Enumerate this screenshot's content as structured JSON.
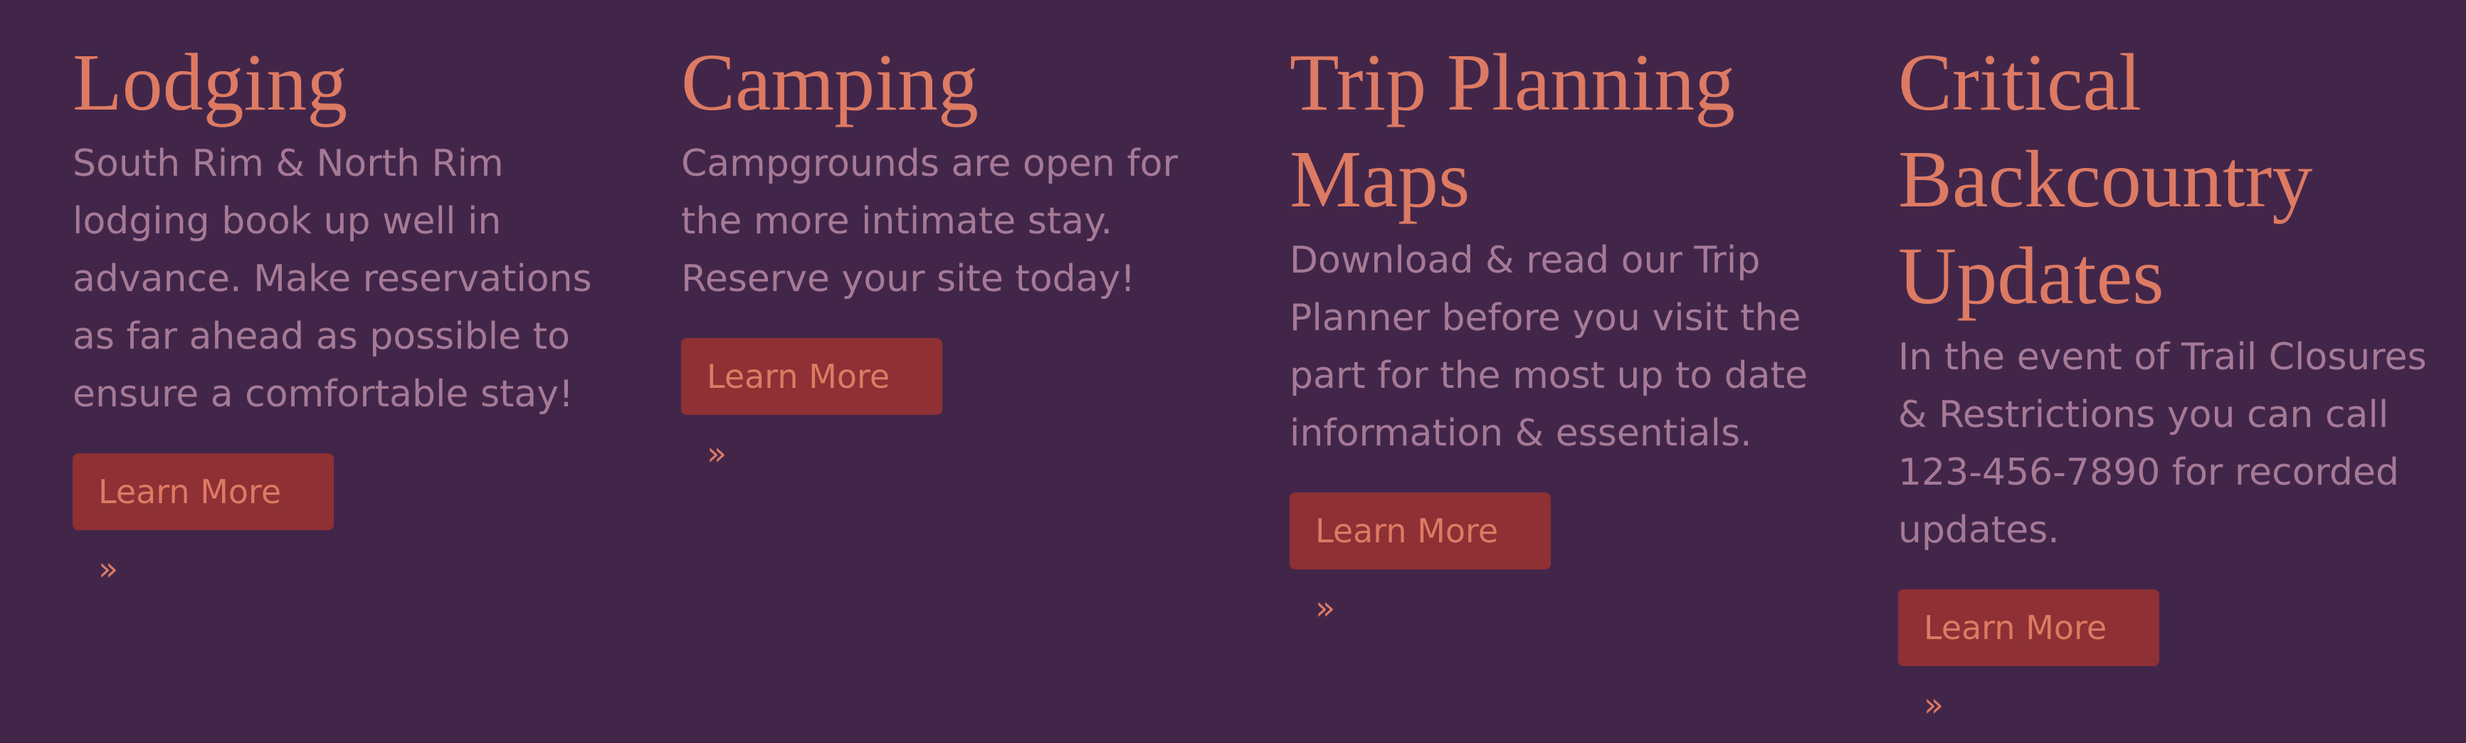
{
  "sections": [
    {
      "title": "Lodging",
      "description": "South Rim & North Rim lodging book up well in advance. Make reservations as far ahead as possible to ensure a comfortable stay!",
      "button_label": "Learn More »"
    },
    {
      "title": "Camping",
      "description": "Campgrounds are open for the more intimate stay. Reserve your site today!",
      "button_label": "Learn More »"
    },
    {
      "title": "Trip Planning Maps",
      "description": "Download & read our Trip Planner before you visit the part for the most up to date information & essentials.",
      "button_label": "Learn More »"
    },
    {
      "title": "Critical Backcountry Updates",
      "description": "In the event of Trail Closures & Restrictions you can call 123-456-7890 for recorded updates.",
      "button_label": "Learn More »"
    }
  ],
  "colors": {
    "background": "#42264a",
    "heading": "#dd7a63",
    "body_text": "#a57a96",
    "button_background": "#8e3034",
    "button_text": "#dd7a63"
  }
}
